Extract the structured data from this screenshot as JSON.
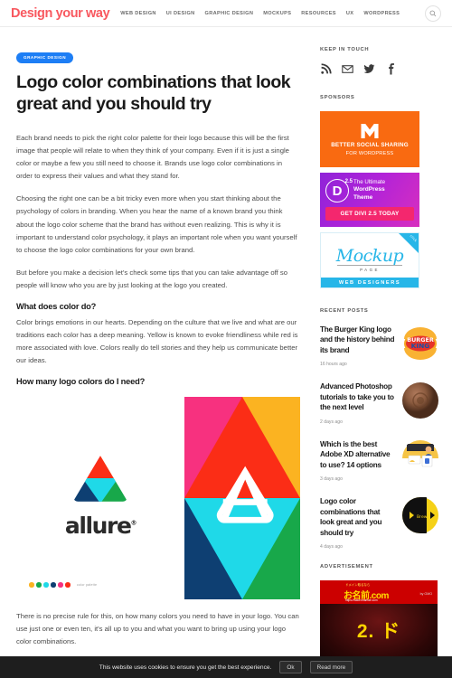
{
  "header": {
    "brand": "Design your way",
    "nav": [
      {
        "label": "WEB DESIGN"
      },
      {
        "label": "UI DESIGN"
      },
      {
        "label": "GRAPHIC DESIGN"
      },
      {
        "label": "MOCKUPS"
      },
      {
        "label": "RESOURCES"
      },
      {
        "label": "UX"
      },
      {
        "label": "WORDPRESS"
      }
    ],
    "search_icon": "search-icon"
  },
  "article": {
    "category": "GRAPHIC DESIGN",
    "title": "Logo color combinations that look great and you should try",
    "paragraphs": [
      "Each brand needs to pick the right color palette for their logo because this will be the first image that people will relate to when they think of your company. Even if it is just a single color or maybe a few you still need to choose it. Brands use logo color combinations in order to express their values and what they stand for.",
      "Choosing the right one can be a bit tricky even more when you start thinking about the psychology of colors in branding. When you hear the name of a known brand you think about the logo color scheme that the brand has without even realizing. This is why it is important to understand color psychology, it plays an important role when you want yourself to choose the logo color combinations for your own brand.",
      "But before you make a decision let's check some tips that you can take advantage off so people will know who you are by just looking at the logo you created."
    ],
    "heading_1": "What does color do?",
    "paragraph_4": "Color brings emotions in our hearts. Depending on the culture that we live and what are our traditions each color has a deep meaning. Yellow is known to evoke friendliness while red is more associated with love. Colors really do tell stories and they help us communicate better our ideas.",
    "heading_2": "How many logo colors do I need?",
    "paragraph_5": "There is no precise rule for this, on how many colors you need to have in your logo. You can use just one or even ten, it's all up to you and what you want to bring up using your logo color combinations.",
    "figure": {
      "brand_word": "allure",
      "palette_label": "color palette",
      "palette": [
        "#fbb321",
        "#18a84a",
        "#1fd9e8",
        "#0e3f72",
        "#f7317f",
        "#fb2d16"
      ]
    }
  },
  "sidebar": {
    "keep_in_touch_title": "KEEP IN TOUCH",
    "social": [
      {
        "name": "rss-icon"
      },
      {
        "name": "email-icon"
      },
      {
        "name": "twitter-icon"
      },
      {
        "name": "facebook-icon"
      }
    ],
    "sponsors_title": "SPONSORS",
    "sponsors": [
      {
        "id": "monarch",
        "line1": "BETTER SOCIAL SHARING",
        "line2": "FOR WORDPRESS"
      },
      {
        "id": "divi",
        "version": "2.5",
        "letter": "D",
        "line1": "The Ultimate",
        "line2": "WordPress",
        "line3": "Theme",
        "button": "GET DIVI 2.5 TODAY"
      },
      {
        "id": "mockup",
        "word": "Mockup",
        "sub": "PAGE",
        "footer": "WEB DESIGNERS",
        "corner": "click"
      }
    ],
    "recent_posts_title": "RECENT POSTS",
    "recent_posts": [
      {
        "title": "The Burger King logo and the history behind its brand",
        "date": "16 hours ago",
        "thumb": "burger-king"
      },
      {
        "title": "Advanced Photoshop tutorials to take you to the next level",
        "date": "2 days ago",
        "thumb": "photoshop-orb"
      },
      {
        "title": "Which is the best Adobe XD alternative to use? 14 options",
        "date": "3 days ago",
        "thumb": "adobe-xd"
      },
      {
        "title": "Logo color combinations that look great and you should try",
        "date": "4 days ago",
        "thumb": "brew-logo"
      }
    ],
    "advertisement_title": "ADVERTISEMENT",
    "advertisement": {
      "top_small": "ドメイン取るなら",
      "top_main": "お名前.com",
      "top_url": "https://www.onamae.com",
      "gmo": "by GMO",
      "big": "2. ド"
    }
  },
  "cookie_bar": {
    "text": "This website uses cookies to ensure you get the best experience.",
    "ok_label": "Ok",
    "read_more_label": "Read more"
  },
  "colors": {
    "brand": "#f8585f",
    "category_badge": "#1d7ef5",
    "sponsor_orange": "#f96a11",
    "mockup_blue": "#27b6e8",
    "divi_pink": "#f4276e"
  }
}
